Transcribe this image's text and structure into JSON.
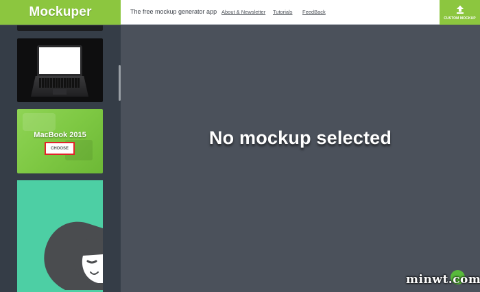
{
  "header": {
    "logo": "Mockuper",
    "tagline": "The free mockup generator app",
    "nav": [
      {
        "label": "About & Newsletter"
      },
      {
        "label": "Tutorials"
      },
      {
        "label": "FeedBack"
      }
    ],
    "custom_button": {
      "label": "CUSTOM MOCKUP",
      "icon": "upload-icon"
    }
  },
  "sidebar": {
    "items": [
      {
        "name": "mockup-thumbnail-top"
      },
      {
        "name": "laptop-mockup"
      },
      {
        "title": "MacBook 2015",
        "button": "CHOOSE"
      },
      {
        "name": "woman-illustration-mockup"
      }
    ]
  },
  "main": {
    "message": "No mockup selected"
  },
  "watermark": {
    "text": "minwt.com"
  },
  "colors": {
    "accent": "#8cc63f",
    "sidebar": "#353d47",
    "main_bg": "#4b515b",
    "highlight_border": "#e2232a"
  }
}
